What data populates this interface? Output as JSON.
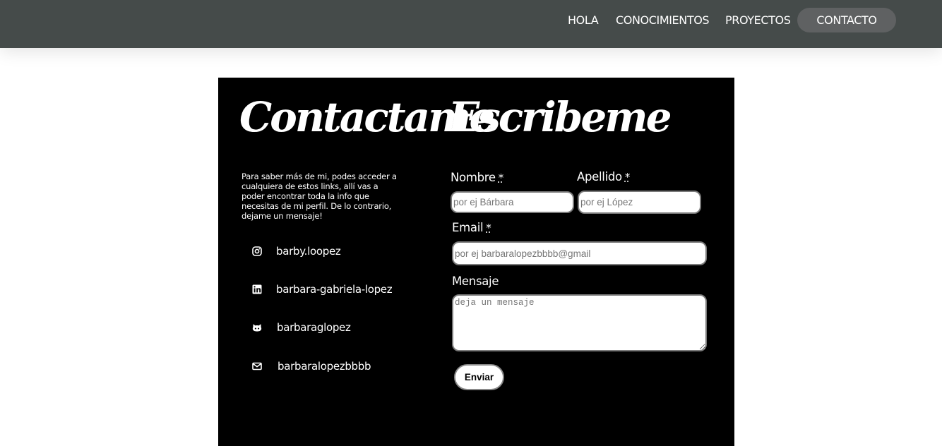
{
  "nav": {
    "items": [
      "HOLA",
      "CONOCIMIENTOS",
      "PROYECTOS",
      "CONTACTO"
    ],
    "active": "CONTACTO"
  },
  "contact": {
    "title": "Contactame",
    "intro": "Para saber más de mi, podes acceder a cualquiera de estos links, allí vas a poder encontrar toda la info que necesitas de mi perfil. De lo contrario, dejame un mensaje!",
    "links": [
      {
        "icon": "instagram-icon",
        "label": "barby.loopez"
      },
      {
        "icon": "linkedin-icon",
        "label": "barbara-gabriela-lopez"
      },
      {
        "icon": "github-icon",
        "label": "barbaraglopez"
      },
      {
        "icon": "mail-icon",
        "label": "barbaralopezbbbb"
      }
    ]
  },
  "form": {
    "title": "Escribeme",
    "required_mark": "*",
    "nombre": {
      "label": "Nombre",
      "placeholder": "por ej Bárbara",
      "value": ""
    },
    "apellido": {
      "label": "Apellido",
      "placeholder": "por ej López",
      "value": ""
    },
    "email": {
      "label": "Email",
      "placeholder": "por ej barbaralopezbbbb@gmail",
      "value": ""
    },
    "mensaje": {
      "label": "Mensaje",
      "placeholder": "deja un mensaje",
      "value": ""
    },
    "submit_label": "Enviar"
  },
  "colors": {
    "topbar": "#454b4a",
    "active_pill": "#5f6162",
    "panel": "#000000",
    "text": "#ffffff"
  }
}
